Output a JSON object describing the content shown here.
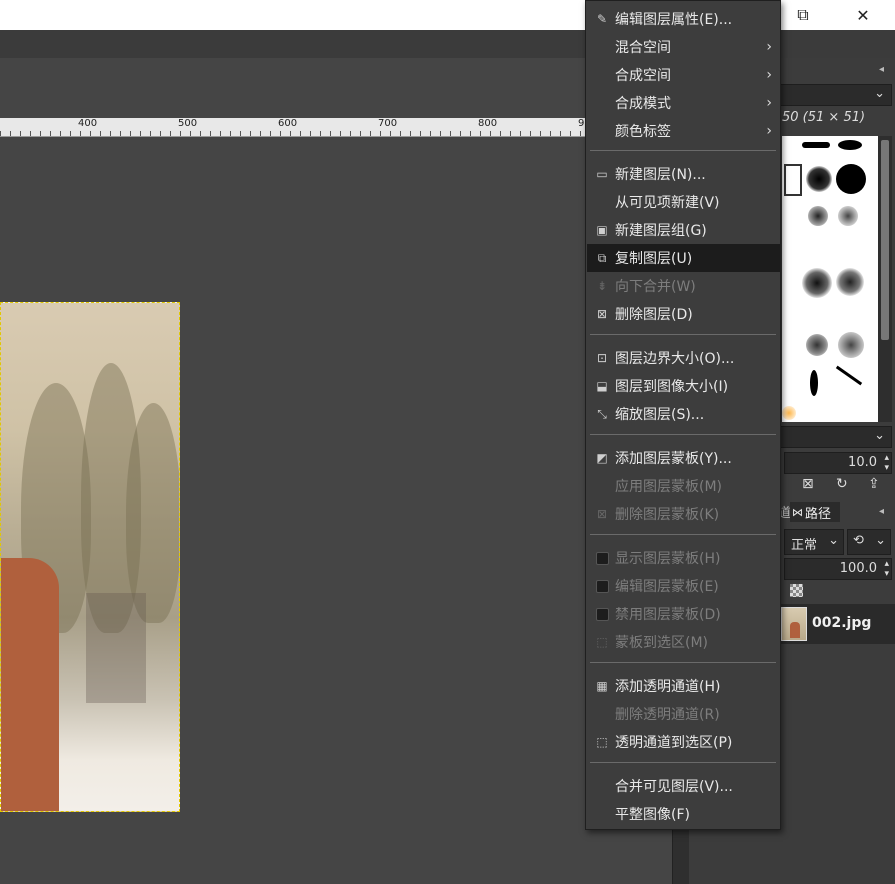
{
  "window": {
    "maximize_glyph": "⧉",
    "close_glyph": "✕"
  },
  "ruler": {
    "labels": [
      "400",
      "500",
      "600",
      "700",
      "800",
      "90"
    ]
  },
  "image": {
    "layer_name": "002.jpg"
  },
  "dock": {
    "brush_info": "50 (51 × 51)",
    "spacing_value": "10.0",
    "mode_label": "正常",
    "opacity_value": "100.0",
    "paths_tab": "路径",
    "paths_tab_prefix": "道"
  },
  "menu": {
    "items": [
      {
        "label": "编辑图层属性(E)...",
        "icon": "edit-icon",
        "enabled": true
      },
      {
        "label": "混合空间",
        "icon": "",
        "enabled": true,
        "submenu": true
      },
      {
        "label": "合成空间",
        "icon": "",
        "enabled": true,
        "submenu": true
      },
      {
        "label": "合成模式",
        "icon": "",
        "enabled": true,
        "submenu": true
      },
      {
        "label": "颜色标签",
        "icon": "",
        "enabled": true,
        "submenu": true
      },
      {
        "label": "新建图层(N)...",
        "icon": "new-layer-icon",
        "enabled": true
      },
      {
        "label": "从可见项新建(V)",
        "icon": "",
        "enabled": true
      },
      {
        "label": "新建图层组(G)",
        "icon": "new-group-icon",
        "enabled": true
      },
      {
        "label": "复制图层(U)",
        "icon": "duplicate-icon",
        "enabled": true,
        "highlighted": true
      },
      {
        "label": "向下合并(W)",
        "icon": "merge-down-icon",
        "enabled": false
      },
      {
        "label": "删除图层(D)",
        "icon": "delete-icon",
        "enabled": true
      },
      {
        "label": "图层边界大小(O)...",
        "icon": "layer-boundary-icon",
        "enabled": true
      },
      {
        "label": "图层到图像大小(I)",
        "icon": "layer-to-image-icon",
        "enabled": true
      },
      {
        "label": "缩放图层(S)...",
        "icon": "scale-layer-icon",
        "enabled": true
      },
      {
        "label": "添加图层蒙板(Y)...",
        "icon": "add-mask-icon",
        "enabled": true
      },
      {
        "label": "应用图层蒙板(M)",
        "icon": "",
        "enabled": false
      },
      {
        "label": "删除图层蒙板(K)",
        "icon": "delete-mask-icon",
        "enabled": false
      },
      {
        "label": "显示图层蒙板(H)",
        "icon": "checkbox-icon",
        "enabled": false
      },
      {
        "label": "编辑图层蒙板(E)",
        "icon": "checkbox-icon",
        "enabled": false
      },
      {
        "label": "禁用图层蒙板(D)",
        "icon": "checkbox-icon",
        "enabled": false
      },
      {
        "label": "蒙板到选区(M)",
        "icon": "mask-to-selection-icon",
        "enabled": false
      },
      {
        "label": "添加透明通道(H)",
        "icon": "alpha-icon",
        "enabled": true
      },
      {
        "label": "删除透明通道(R)",
        "icon": "",
        "enabled": false
      },
      {
        "label": "透明通道到选区(P)",
        "icon": "alpha-to-selection-icon",
        "enabled": true
      },
      {
        "label": "合并可见图层(V)...",
        "icon": "",
        "enabled": true
      },
      {
        "label": "平整图像(F)",
        "icon": "",
        "enabled": true
      }
    ]
  }
}
